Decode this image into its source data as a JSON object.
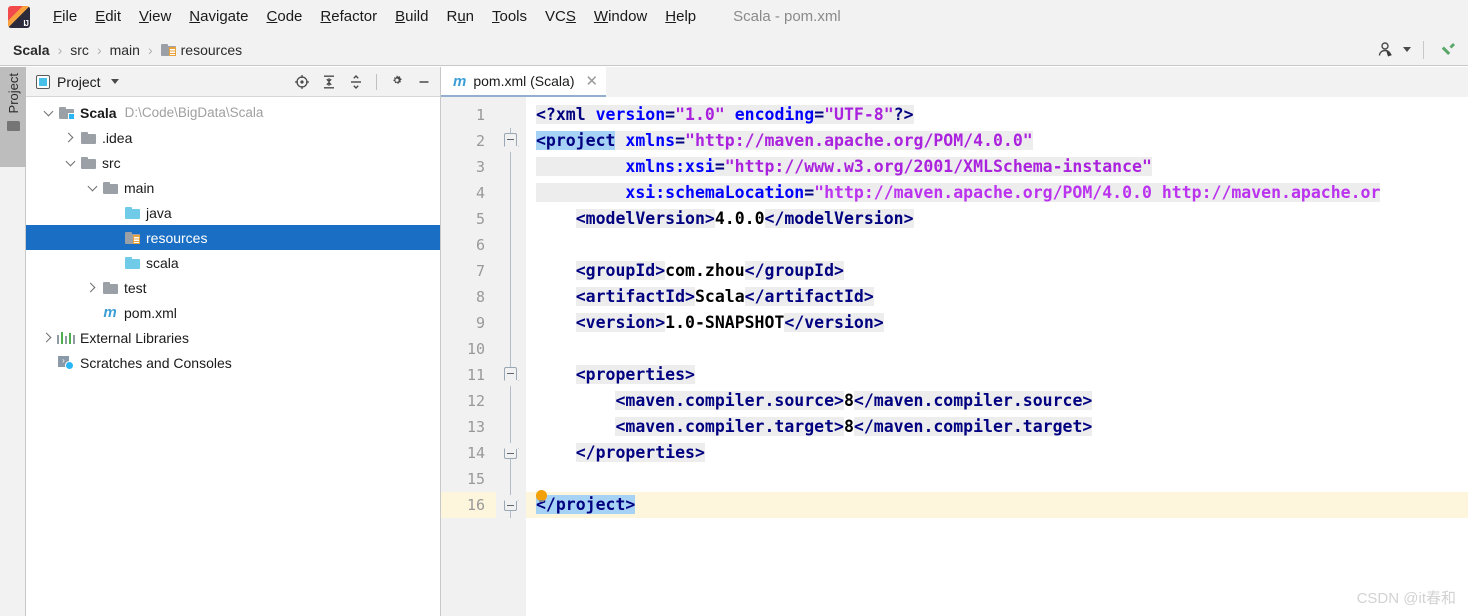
{
  "window": {
    "title": "Scala - pom.xml"
  },
  "menubar": {
    "logo": "intellij-idea-logo",
    "items": [
      {
        "label": "File",
        "pre": "",
        "mn": "F",
        "post": "ile"
      },
      {
        "label": "Edit",
        "pre": "",
        "mn": "E",
        "post": "dit"
      },
      {
        "label": "View",
        "pre": "",
        "mn": "V",
        "post": "iew"
      },
      {
        "label": "Navigate",
        "pre": "",
        "mn": "N",
        "post": "avigate"
      },
      {
        "label": "Code",
        "pre": "",
        "mn": "C",
        "post": "ode"
      },
      {
        "label": "Refactor",
        "pre": "",
        "mn": "R",
        "post": "efactor"
      },
      {
        "label": "Build",
        "pre": "",
        "mn": "B",
        "post": "uild"
      },
      {
        "label": "Run",
        "pre": "R",
        "mn": "u",
        "post": "n"
      },
      {
        "label": "Tools",
        "pre": "",
        "mn": "T",
        "post": "ools"
      },
      {
        "label": "VCS",
        "pre": "VC",
        "mn": "S",
        "post": ""
      },
      {
        "label": "Window",
        "pre": "",
        "mn": "W",
        "post": "indow"
      },
      {
        "label": "Help",
        "pre": "",
        "mn": "H",
        "post": "elp"
      }
    ]
  },
  "breadcrumb": {
    "separator": "›",
    "items": [
      {
        "label": "Scala",
        "bold": true,
        "icon": ""
      },
      {
        "label": "src",
        "bold": false,
        "icon": ""
      },
      {
        "label": "main",
        "bold": false,
        "icon": ""
      },
      {
        "label": "resources",
        "bold": false,
        "icon": "resources-folder-icon"
      }
    ],
    "right_icons": [
      "user-account-icon",
      "chevron-down-icon",
      "build-hammer-icon"
    ]
  },
  "toolstrip": {
    "project_tab_label": "Project",
    "project_tab_icon": "folder-icon"
  },
  "project_panel": {
    "title": "Project",
    "title_icon": "project-view-icon",
    "dropdown_icon": "chevron-down-icon",
    "tools": [
      "locate-target-icon",
      "expand-all-icon",
      "collapse-all-icon",
      "settings-gear-icon",
      "minimize-icon"
    ],
    "tree": [
      {
        "label": "Scala",
        "sub": "D:\\Code\\BigData\\Scala",
        "indent": 0,
        "arrow": "down",
        "icon": "module-folder-icon",
        "bold": true,
        "selected": false
      },
      {
        "label": ".idea",
        "sub": "",
        "indent": 1,
        "arrow": "right",
        "icon": "folder-icon",
        "bold": false,
        "selected": false
      },
      {
        "label": "src",
        "sub": "",
        "indent": 1,
        "arrow": "down",
        "icon": "folder-icon",
        "bold": false,
        "selected": false
      },
      {
        "label": "main",
        "sub": "",
        "indent": 2,
        "arrow": "down",
        "icon": "folder-icon",
        "bold": false,
        "selected": false
      },
      {
        "label": "java",
        "sub": "",
        "indent": 3,
        "arrow": "none",
        "icon": "sources-folder-icon",
        "bold": false,
        "selected": false
      },
      {
        "label": "resources",
        "sub": "",
        "indent": 3,
        "arrow": "none",
        "icon": "resources-folder-icon",
        "bold": false,
        "selected": true
      },
      {
        "label": "scala",
        "sub": "",
        "indent": 3,
        "arrow": "none",
        "icon": "sources-folder-icon",
        "bold": false,
        "selected": false
      },
      {
        "label": "test",
        "sub": "",
        "indent": 2,
        "arrow": "right",
        "icon": "folder-icon",
        "bold": false,
        "selected": false
      },
      {
        "label": "pom.xml",
        "sub": "",
        "indent": 2,
        "arrow": "none",
        "icon": "maven-file-icon",
        "bold": false,
        "selected": false
      },
      {
        "label": "External Libraries",
        "sub": "",
        "indent": 0,
        "arrow": "right",
        "icon": "libraries-icon",
        "bold": false,
        "selected": false
      },
      {
        "label": "Scratches and Consoles",
        "sub": "",
        "indent": 0,
        "arrow": "none",
        "icon": "scratches-icon",
        "bold": false,
        "selected": false
      }
    ]
  },
  "editor": {
    "tab": {
      "icon": "maven-file-icon",
      "label": "pom.xml (Scala)",
      "close_icon": "close-icon"
    },
    "current_line": 16,
    "lines": [
      {
        "n": 1,
        "fold": "none",
        "segs": [
          {
            "t": "tag",
            "s": "<?xml "
          },
          {
            "t": "attr",
            "s": "version"
          },
          {
            "t": "tag",
            "s": "="
          },
          {
            "t": "val",
            "s": "\"1.0\""
          },
          {
            "t": "tag",
            "s": " "
          },
          {
            "t": "attr",
            "s": "encoding"
          },
          {
            "t": "tag",
            "s": "="
          },
          {
            "t": "val",
            "s": "\"UTF-8\""
          },
          {
            "t": "tag",
            "s": "?>"
          }
        ]
      },
      {
        "n": 2,
        "fold": "start",
        "segs": [
          {
            "t": "tagsel",
            "s": "<project"
          },
          {
            "t": "tag",
            "s": " "
          },
          {
            "t": "attr",
            "s": "xmlns"
          },
          {
            "t": "tag",
            "s": "="
          },
          {
            "t": "val",
            "s": "\"http://maven.apache.org/POM/4.0.0\""
          }
        ]
      },
      {
        "n": 3,
        "fold": "line",
        "segs": [
          {
            "t": "tag",
            "s": "         "
          },
          {
            "t": "attr",
            "s": "xmlns:xsi"
          },
          {
            "t": "tag",
            "s": "="
          },
          {
            "t": "val",
            "s": "\"http://www.w3.org/2001/XMLSchema-instance\""
          }
        ]
      },
      {
        "n": 4,
        "fold": "line",
        "segs": [
          {
            "t": "tag",
            "s": "         "
          },
          {
            "t": "attr",
            "s": "xsi:schemaLocation"
          },
          {
            "t": "tag",
            "s": "="
          },
          {
            "t": "val2",
            "s": "\"http://maven.apache.org/POM/4.0.0 http://maven.apache.or"
          }
        ]
      },
      {
        "n": 5,
        "fold": "line",
        "segs": [
          {
            "t": "txt",
            "s": "    "
          },
          {
            "t": "tag",
            "s": "<modelVersion>"
          },
          {
            "t": "txt",
            "s": "4.0.0"
          },
          {
            "t": "tag",
            "s": "</modelVersion>"
          }
        ]
      },
      {
        "n": 6,
        "fold": "line",
        "segs": []
      },
      {
        "n": 7,
        "fold": "line",
        "segs": [
          {
            "t": "txt",
            "s": "    "
          },
          {
            "t": "tag",
            "s": "<groupId>"
          },
          {
            "t": "txt",
            "s": "com.zhou"
          },
          {
            "t": "tag",
            "s": "</groupId>"
          }
        ]
      },
      {
        "n": 8,
        "fold": "line",
        "segs": [
          {
            "t": "txt",
            "s": "    "
          },
          {
            "t": "tag",
            "s": "<artifactId>"
          },
          {
            "t": "txt",
            "s": "Scala"
          },
          {
            "t": "tag",
            "s": "</artifactId>"
          }
        ]
      },
      {
        "n": 9,
        "fold": "line",
        "segs": [
          {
            "t": "txt",
            "s": "    "
          },
          {
            "t": "tag",
            "s": "<version>"
          },
          {
            "t": "txt",
            "s": "1.0-SNAPSHOT"
          },
          {
            "t": "tag",
            "s": "</version>"
          }
        ]
      },
      {
        "n": 10,
        "fold": "line",
        "segs": []
      },
      {
        "n": 11,
        "fold": "start2",
        "segs": [
          {
            "t": "txt",
            "s": "    "
          },
          {
            "t": "tag",
            "s": "<properties>"
          }
        ]
      },
      {
        "n": 12,
        "fold": "line",
        "segs": [
          {
            "t": "txt",
            "s": "        "
          },
          {
            "t": "tag",
            "s": "<maven.compiler.source>"
          },
          {
            "t": "txt",
            "s": "8"
          },
          {
            "t": "tag",
            "s": "</maven.compiler.source>"
          }
        ]
      },
      {
        "n": 13,
        "fold": "line",
        "segs": [
          {
            "t": "txt",
            "s": "        "
          },
          {
            "t": "tag",
            "s": "<maven.compiler.target>"
          },
          {
            "t": "txt",
            "s": "8"
          },
          {
            "t": "tag",
            "s": "</maven.compiler.target>"
          }
        ]
      },
      {
        "n": 14,
        "fold": "end2",
        "segs": [
          {
            "t": "txt",
            "s": "    "
          },
          {
            "t": "tag",
            "s": "</properties>"
          }
        ]
      },
      {
        "n": 15,
        "fold": "line",
        "bulb": true,
        "segs": []
      },
      {
        "n": 16,
        "fold": "end",
        "current": true,
        "segs": [
          {
            "t": "tagsel",
            "s": "</project>"
          }
        ]
      }
    ],
    "bulb_icon": "lightbulb-intention-icon"
  },
  "watermark": "CSDN @it春和",
  "colors": {
    "selection_blue": "#1a6fc4",
    "tag_navy": "#000080",
    "attr_blue": "#0000ff",
    "value_purple": "#aa22dd",
    "current_line": "#fdf6dd",
    "chrome_gray": "#f2f2f2"
  }
}
